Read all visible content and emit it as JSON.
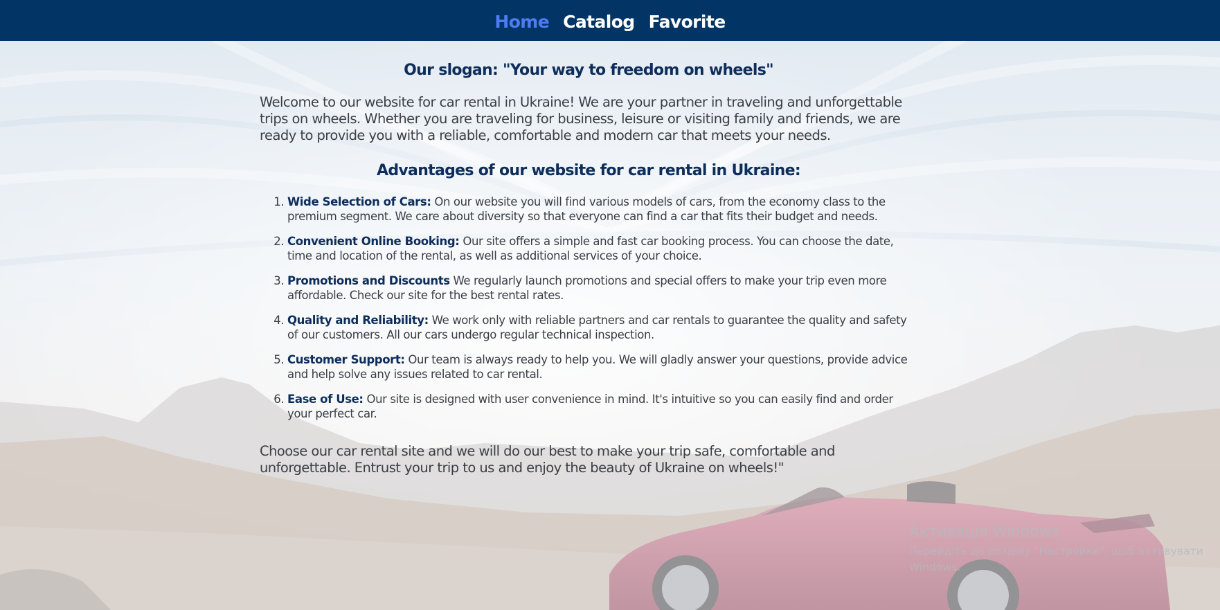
{
  "nav": {
    "items": [
      {
        "label": "Home",
        "active": true
      },
      {
        "label": "Catalog",
        "active": false
      },
      {
        "label": "Favorite",
        "active": false
      }
    ]
  },
  "main": {
    "slogan": "Our slogan: \"Your way to freedom on wheels\"",
    "intro": "Welcome to our website for car rental in Ukraine! We are your partner in traveling and unforgettable trips on wheels. Whether you are traveling for business, leisure or visiting family and friends, we are ready to provide you with a reliable, comfortable and modern car that meets your needs.",
    "advantages_title": "Advantages of our website for car rental in Ukraine:",
    "advantages": [
      {
        "lead": "Wide Selection of Cars:",
        "text": " On our website you will find various models of cars, from the economy class to the premium segment. We care about diversity so that everyone can find a car that fits their budget and needs."
      },
      {
        "lead": "Convenient Online Booking:",
        "text": " Our site offers a simple and fast car booking process. You can choose the date, time and location of the rental, as well as additional services of your choice."
      },
      {
        "lead": "Promotions and Discounts",
        "text": " We regularly launch promotions and special offers to make your trip even more affordable. Check our site for the best rental rates."
      },
      {
        "lead": "Quality and Reliability:",
        "text": " We work only with reliable partners and car rentals to guarantee the quality and safety of our customers. All our cars undergo regular technical inspection."
      },
      {
        "lead": "Customer Support:",
        "text": " Our team is always ready to help you. We will gladly answer your questions, provide advice and help solve any issues related to car rental."
      },
      {
        "lead": "Ease of Use:",
        "text": " Our site is designed with user convenience in mind. It's intuitive so you can easily find and order your perfect car."
      }
    ],
    "outro": "Choose our car rental site and we will do our best to make your trip safe, comfortable and unforgettable. Entrust your trip to us and enjoy the beauty of Ukraine on wheels!\""
  },
  "watermark": {
    "title": "Активація Windows",
    "subtitle": "Перейдіть до розділу \"Настройки\", щоб активувати Windows."
  },
  "colors": {
    "nav_bg": "#023466",
    "nav_active": "#4e7cf4",
    "heading": "#0d2d5a",
    "body_text": "#3a3e44"
  }
}
